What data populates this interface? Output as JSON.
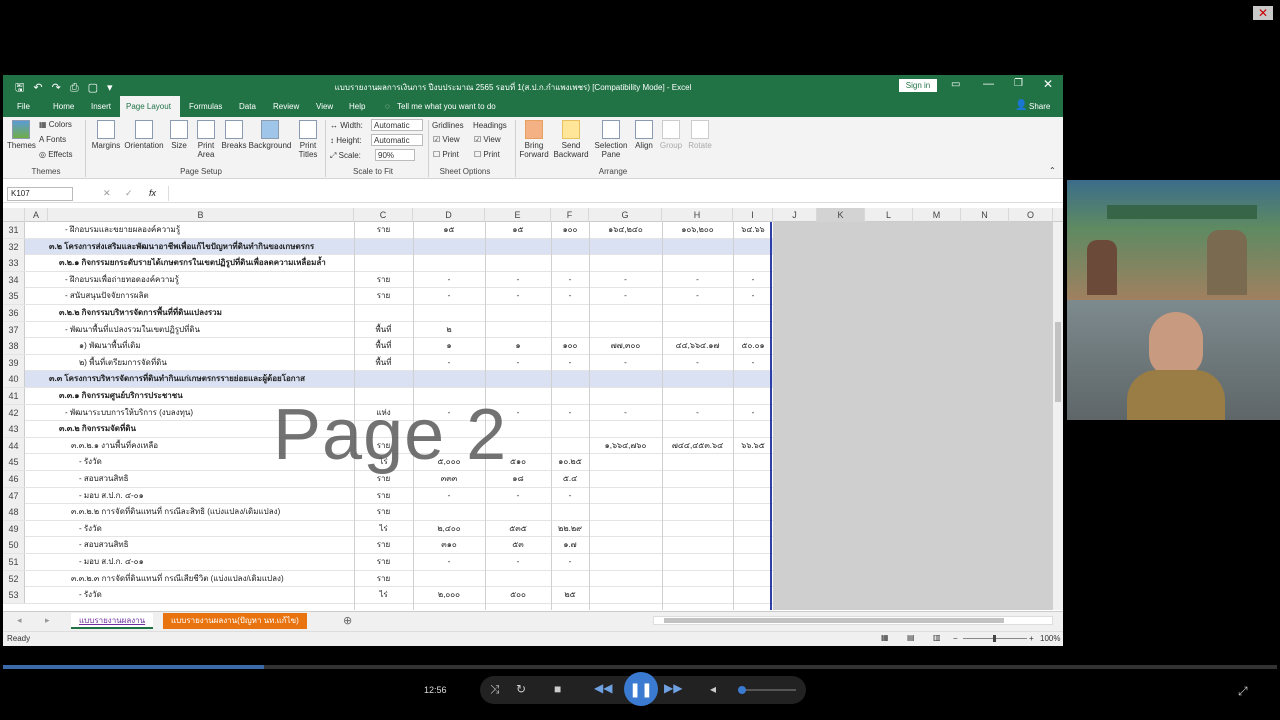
{
  "window": {
    "title": "แบบรายงานผลการเงินการ ปีงบประมาณ 2565 รอบที่ 1(ส.ป.ก.กำแพงเพชร) [Compatibility Mode] - Excel",
    "sign_in": "Sign in",
    "share": "Share",
    "close_overlay": "✕"
  },
  "ribbon": {
    "tabs": [
      "File",
      "Home",
      "Insert",
      "Page Layout",
      "Formulas",
      "Data",
      "Review",
      "View",
      "Help"
    ],
    "active_tab": "Page Layout",
    "tell_me": "Tell me what you want to do",
    "themes": {
      "themes": "Themes",
      "colors": "Colors",
      "fonts": "Fonts",
      "effects": "Effects",
      "group": "Themes"
    },
    "page_setup": {
      "margins": "Margins",
      "orientation": "Orientation",
      "size": "Size",
      "print_area": "Print Area",
      "breaks": "Breaks",
      "background": "Background",
      "print_titles": "Print Titles",
      "group": "Page Setup"
    },
    "scale_to_fit": {
      "width_label": "Width:",
      "width_value": "Automatic",
      "height_label": "Height:",
      "height_value": "Automatic",
      "scale_label": "Scale:",
      "scale_value": "90%",
      "group": "Scale to Fit"
    },
    "sheet_options": {
      "gridlines": "Gridlines",
      "headings": "Headings",
      "view": "View",
      "print": "Print",
      "group": "Sheet Options"
    },
    "arrange": {
      "bring_forward": "Bring Forward",
      "send_backward": "Send Backward",
      "selection_pane": "Selection Pane",
      "align": "Align",
      "group_btn": "Group",
      "rotate": "Rotate",
      "group": "Arrange"
    }
  },
  "formula_bar": {
    "name_box": "K107",
    "fx": "fx",
    "formula": ""
  },
  "columns": [
    "A",
    "B",
    "C",
    "D",
    "E",
    "F",
    "G",
    "H",
    "I",
    "J",
    "K",
    "L",
    "M",
    "N",
    "O"
  ],
  "rows": [
    {
      "n": "31",
      "b": "- ฝึกอบรมและขยายผลองค์ความรู้",
      "c": "ราย",
      "d": "๑๕",
      "e": "๑๕",
      "f": "๑๐๐",
      "g": "๑๖๔,๒๔๐",
      "h": "๑๐๖,๒๐๐",
      "i": "๖๔.๖๖",
      "hl": false,
      "ind": 16
    },
    {
      "n": "32",
      "b": "๓.๒ โครงการส่งเสริมและพัฒนาอาชีพเพื่อแก้ไขปัญหาที่ดินทำกินของเกษตรกร",
      "c": "",
      "d": "",
      "e": "",
      "f": "",
      "g": "",
      "h": "",
      "i": "",
      "hl": true,
      "ind": 0
    },
    {
      "n": "33",
      "b": "๓.๒.๑ กิจกรรมยกระดับรายได้เกษตรกรในเขตปฏิรูปที่ดินเพื่อลดความเหลื่อมล้ำ",
      "c": "",
      "d": "",
      "e": "",
      "f": "",
      "g": "",
      "h": "",
      "i": "",
      "hl": false,
      "ind": 10
    },
    {
      "n": "34",
      "b": "- ฝึกอบรมเพื่อถ่ายทอดองค์ความรู้",
      "c": "ราย",
      "d": "-",
      "e": "-",
      "f": "-",
      "g": "-",
      "h": "-",
      "i": "-",
      "hl": false,
      "ind": 16
    },
    {
      "n": "35",
      "b": "- สนับสนุนปัจจัยการผลิต",
      "c": "ราย",
      "d": "-",
      "e": "-",
      "f": "-",
      "g": "-",
      "h": "-",
      "i": "-",
      "hl": false,
      "ind": 16
    },
    {
      "n": "36",
      "b": "๓.๒.๒ กิจกรรมบริหารจัดการพื้นที่ที่ดินแปลงรวม",
      "c": "",
      "d": "",
      "e": "",
      "f": "",
      "g": "",
      "h": "",
      "i": "",
      "hl": false,
      "ind": 10
    },
    {
      "n": "37",
      "b": "- พัฒนาพื้นที่แปลงรวมในเขตปฏิรูปที่ดิน",
      "c": "พื้นที่",
      "d": "๒",
      "e": "",
      "f": "",
      "g": "",
      "h": "",
      "i": "",
      "hl": false,
      "ind": 16
    },
    {
      "n": "38",
      "b": "๑) พัฒนาพื้นที่เดิม",
      "c": "พื้นที่",
      "d": "๑",
      "e": "๑",
      "f": "๑๐๐",
      "g": "๗๗,๓๐๐",
      "h": "๔๔,๖๖๔.๑๗",
      "i": "๕๐.๐๑",
      "hl": false,
      "ind": 30
    },
    {
      "n": "39",
      "b": "๒) พื้นที่เตรียมการจัดที่ดิน",
      "c": "พื้นที่",
      "d": "-",
      "e": "-",
      "f": "-",
      "g": "-",
      "h": "-",
      "i": "-",
      "hl": false,
      "ind": 30
    },
    {
      "n": "40",
      "b": "๓.๓ โครงการบริหารจัดการที่ดินทำกินแก่เกษตรกรรายย่อยและผู้ด้อยโอกาส",
      "c": "",
      "d": "",
      "e": "",
      "f": "",
      "g": "",
      "h": "",
      "i": "",
      "hl": true,
      "ind": 0
    },
    {
      "n": "41",
      "b": "๓.๓.๑ กิจกรรมศูนย์บริการประชาชน",
      "c": "",
      "d": "",
      "e": "",
      "f": "",
      "g": "",
      "h": "",
      "i": "",
      "hl": false,
      "ind": 10
    },
    {
      "n": "42",
      "b": "- พัฒนาระบบการให้บริการ (งบลงทุน)",
      "c": "แห่ง",
      "d": "-",
      "e": "-",
      "f": "-",
      "g": "-",
      "h": "-",
      "i": "-",
      "hl": false,
      "ind": 16
    },
    {
      "n": "43",
      "b": "๓.๓.๒ กิจกรรมจัดที่ดิน",
      "c": "",
      "d": "",
      "e": "",
      "f": "",
      "g": "",
      "h": "",
      "i": "",
      "hl": false,
      "ind": 10
    },
    {
      "n": "44",
      "b": "๓.๓.๒.๑ งานพื้นที่คงเหลือ",
      "c": "ราย",
      "d": "",
      "e": "",
      "f": "",
      "g": "๑,๖๖๔,๗๖๐",
      "h": "๗๔๔,๔๕๓.๖๔",
      "i": "๖๖.๖๕",
      "hl": false,
      "ind": 22
    },
    {
      "n": "45",
      "b": "- รังวัด",
      "c": "ไร่",
      "d": "๕,๐๐๐",
      "e": "๕๑๐",
      "f": "๑๐.๒๕",
      "g": "",
      "h": "",
      "i": "",
      "hl": false,
      "ind": 30
    },
    {
      "n": "46",
      "b": "- สอบสวนสิทธิ",
      "c": "ราย",
      "d": "๓๓๓",
      "e": "๑๘",
      "f": "๕.๔",
      "g": "",
      "h": "",
      "i": "",
      "hl": false,
      "ind": 30
    },
    {
      "n": "47",
      "b": "- มอบ ส.ป.ก. ๔-๐๑",
      "c": "ราย",
      "d": "-",
      "e": "-",
      "f": "-",
      "g": "",
      "h": "",
      "i": "",
      "hl": false,
      "ind": 30
    },
    {
      "n": "48",
      "b": "๓.๓.๒.๒ การจัดที่ดินแทนที่ กรณีละสิทธิ (แบ่งแปลง/เดิมแปลง)",
      "c": "ราย",
      "d": "",
      "e": "",
      "f": "",
      "g": "",
      "h": "",
      "i": "",
      "hl": false,
      "ind": 22
    },
    {
      "n": "49",
      "b": "- รังวัด",
      "c": "ไร่",
      "d": "๒,๔๐๐",
      "e": "๕๓๕",
      "f": "๒๒.๒๙",
      "g": "",
      "h": "",
      "i": "",
      "hl": false,
      "ind": 30
    },
    {
      "n": "50",
      "b": "- สอบสวนสิทธิ",
      "c": "ราย",
      "d": "๓๑๐",
      "e": "๕๓",
      "f": "๑.๗",
      "g": "",
      "h": "",
      "i": "",
      "hl": false,
      "ind": 30
    },
    {
      "n": "51",
      "b": "- มอบ ส.ป.ก. ๔-๐๑",
      "c": "ราย",
      "d": "-",
      "e": "-",
      "f": "-",
      "g": "",
      "h": "",
      "i": "",
      "hl": false,
      "ind": 30
    },
    {
      "n": "52",
      "b": "๓.๓.๒.๓ การจัดที่ดินแทนที่ กรณีเสียชีวิต (แบ่งแปลง/เดิมแปลง)",
      "c": "ราย",
      "d": "",
      "e": "",
      "f": "",
      "g": "",
      "h": "",
      "i": "",
      "hl": false,
      "ind": 22
    },
    {
      "n": "53",
      "b": "- รังวัด",
      "c": "ไร่",
      "d": "๒,๐๐๐",
      "e": "๕๐๐",
      "f": "๒๕",
      "g": "",
      "h": "",
      "i": "",
      "hl": false,
      "ind": 30
    }
  ],
  "watermark": "Page 2",
  "sheet_tabs": [
    "แบบรายงานผลงาน",
    "แบบรายงานผลงาน(ปัญหา นท.แก้ไข)"
  ],
  "status": {
    "ready": "Ready",
    "zoom": "100%"
  },
  "player": {
    "time": "12:56",
    "progress": 0.205
  }
}
